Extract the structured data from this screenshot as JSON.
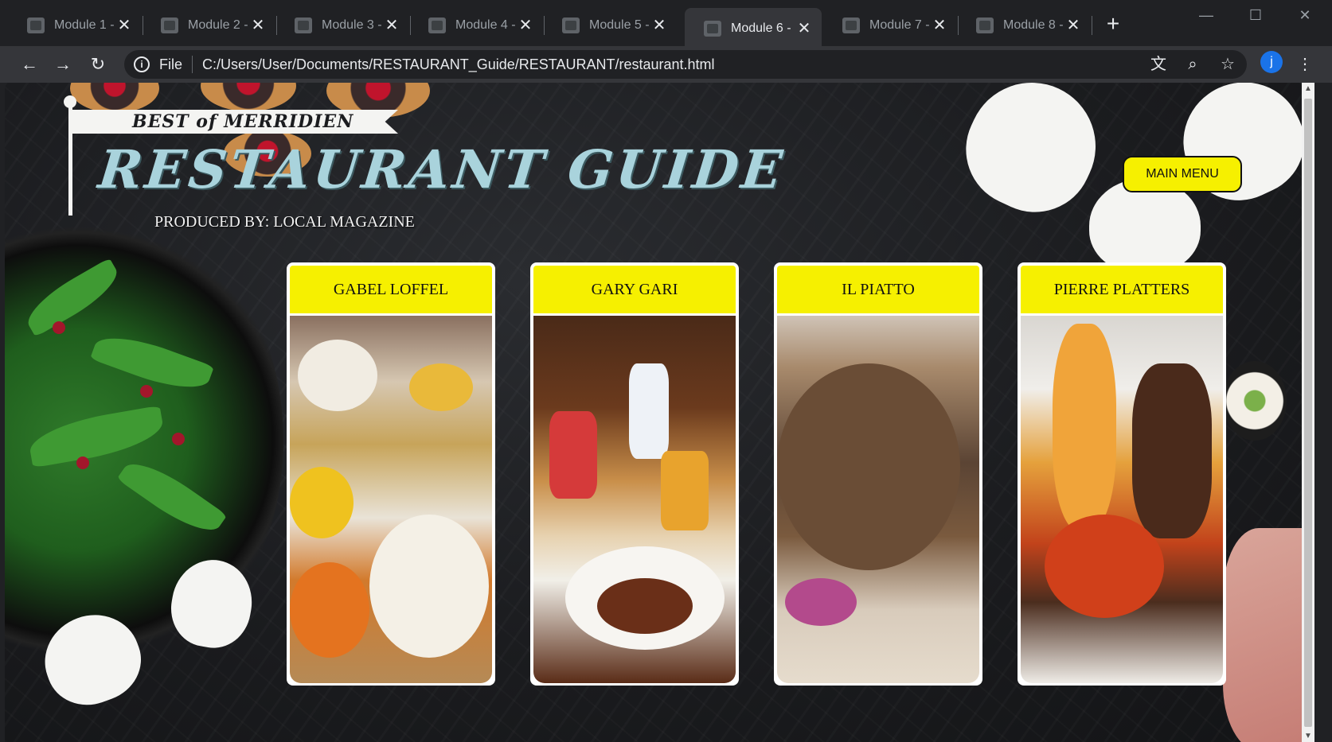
{
  "browser": {
    "tabs": [
      {
        "label": "Module 1 -"
      },
      {
        "label": "Module 2 -"
      },
      {
        "label": "Module 3 -"
      },
      {
        "label": "Module 4 -"
      },
      {
        "label": "Module 5 -"
      },
      {
        "label": "Module 6 -"
      },
      {
        "label": "Module 7 -"
      },
      {
        "label": "Module 8 -"
      }
    ],
    "active_tab_index": 5,
    "new_tab_label": "+",
    "scheme_label": "File",
    "url": "C:/Users/User/Documents/RESTAURANT_Guide/RESTAURANT/restaurant.html",
    "avatar_letter": "j"
  },
  "page": {
    "ribbon_text": "BEST of MERRIDIEN",
    "title": "RESTAURANT GUIDE",
    "byline": "PRODUCED BY: LOCAL MAGAZINE",
    "main_menu_label": "MAIN MENU",
    "restaurants": [
      {
        "name": "GABEL LOFFEL"
      },
      {
        "name": "GARY GARI"
      },
      {
        "name": "IL PIATTO"
      },
      {
        "name": "PIERRE PLATTERS"
      }
    ]
  },
  "colors": {
    "accent_yellow": "#f6f000",
    "title_blue": "#a9d3dc",
    "background_slate": "#1b1c1f"
  }
}
